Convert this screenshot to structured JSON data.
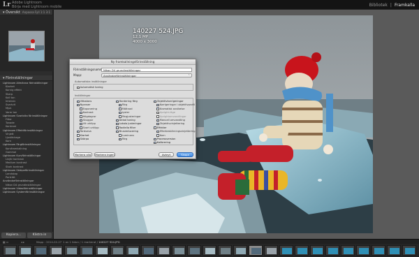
{
  "app": {
    "logo": "Lr",
    "id_plate_line1": "Adobe Lightroom",
    "id_plate_line2": "Börja med Lightroom mobile",
    "modules": [
      "Bibliotek",
      "Framkalla"
    ],
    "active_module": "Framkalla"
  },
  "left_panel": {
    "navigator_label": "Översikt",
    "navigator_options": [
      "Anpassa",
      "Fyll",
      "1:1",
      "3:1"
    ],
    "presets_label": "Förinställningar",
    "presets": [
      {
        "label": "Lightroom Allmänna förinställningar",
        "folder": true
      },
      {
        "label": "Klarhet",
        "folder": false
      },
      {
        "label": "Kornig effekt",
        "folder": false
      },
      {
        "label": "Skarp",
        "folder": false
      },
      {
        "label": "Kall ton",
        "folder": false
      },
      {
        "label": "Intensiv",
        "folder": false
      },
      {
        "label": "Svartvit",
        "folder": false
      },
      {
        "label": "Mjuk",
        "folder": false
      },
      {
        "label": "Varm ton",
        "folder": false
      },
      {
        "label": "Lightroom Svartvita förinställningar",
        "folder": true
      },
      {
        "label": "Filter",
        "folder": false
      },
      {
        "label": "Tonade",
        "folder": false
      },
      {
        "label": "Kontrast",
        "folder": false
      },
      {
        "label": "Lightroom Effektförinställningar",
        "folder": true
      },
      {
        "label": "Vinjett",
        "folder": false
      },
      {
        "label": "Ljusläckage",
        "folder": false
      },
      {
        "label": "Korn",
        "folder": false
      },
      {
        "label": "Lightroom Färgförinställningar",
        "folder": true
      },
      {
        "label": "Korsframkallning",
        "folder": false
      },
      {
        "label": "Gammal",
        "folder": false
      },
      {
        "label": "Lightroom Kurvförinställningar",
        "folder": true
      },
      {
        "label": "Linjär kontrast",
        "folder": false
      },
      {
        "label": "Medium kontrast",
        "folder": false
      },
      {
        "label": "Stark kontrast",
        "folder": false
      },
      {
        "label": "Lightroom Skärpeförinställningar",
        "folder": true
      },
      {
        "label": "Landskap",
        "folder": false
      },
      {
        "label": "Porträtt",
        "folder": false
      },
      {
        "label": "Användarförinställningar",
        "folder": true
      },
      {
        "label": "Nikon D4 grundinställningar",
        "folder": false
      },
      {
        "label": "Lightroom Videoförinställningar",
        "folder": true
      },
      {
        "label": "Lightroom Systemförinställningar",
        "folder": true
      }
    ],
    "copy_button": "Kopiera...",
    "paste_button": "Klistra in"
  },
  "photo_info": {
    "title": "140227 524.JPG",
    "line1": "12,1 MP",
    "line2": "4000 x 3000"
  },
  "dialog": {
    "title": "Ny framkallningsförinställning",
    "name_label": "Förinställningsnamn:",
    "name_value": "Nikon D4 grundinställningar",
    "folder_label": "Mapp:",
    "folder_value": "Användarförinställningar",
    "auto_group_label": "Automatiska inställningar",
    "auto_tone_label": "Automatisk toning",
    "settings_group_label": "Inställningar",
    "col1": [
      {
        "label": "Vitbalans",
        "checked": true,
        "level": 0
      },
      {
        "label": "Nyanser",
        "checked": true,
        "level": 0
      },
      {
        "label": "Exponering",
        "checked": true,
        "level": 1
      },
      {
        "label": "Kontrast",
        "checked": true,
        "level": 1
      },
      {
        "label": "Högdagrar",
        "checked": true,
        "level": 1
      },
      {
        "label": "Skuggor",
        "checked": true,
        "level": 1
      },
      {
        "label": "Vit urklipp",
        "checked": true,
        "level": 1
      },
      {
        "label": "Svart urklipp",
        "checked": true,
        "level": 1
      },
      {
        "label": "Tonkurva",
        "checked": true,
        "level": 0
      },
      {
        "label": "Klarhet",
        "checked": true,
        "level": 0
      },
      {
        "label": "Skärpa",
        "checked": true,
        "level": 0
      }
    ],
    "col2": [
      {
        "label": "Hantering färg",
        "checked": true,
        "level": 0
      },
      {
        "label": "Färg",
        "checked": true,
        "level": 1
      },
      {
        "label": "Mättnad",
        "checked": true,
        "level": 1
      },
      {
        "label": "Lyster",
        "checked": true,
        "level": 1
      },
      {
        "label": "Färgjusteringar",
        "checked": true,
        "level": 1
      },
      {
        "label": "Delad toning",
        "checked": true,
        "level": 0
      },
      {
        "label": "Lokala justeringar",
        "checked": true,
        "level": 0
      },
      {
        "label": "Radiella filter",
        "checked": true,
        "level": 0
      },
      {
        "label": "Brusreducering",
        "checked": true,
        "level": 0
      },
      {
        "label": "Luminans",
        "checked": true,
        "level": 1
      },
      {
        "label": "Färg",
        "checked": true,
        "level": 1
      }
    ],
    "col3": [
      {
        "label": "Objektivkorrigeringar",
        "checked": true,
        "level": 0
      },
      {
        "label": "Korrigeringar i objektivprofil",
        "checked": true,
        "level": 1
      },
      {
        "label": "Kromatisk avvikelse",
        "checked": true,
        "level": 1
      },
      {
        "label": "Upright-läge",
        "checked": false,
        "level": 1
      },
      {
        "label": "Uprightomvandlingar",
        "checked": false,
        "level": 1
      },
      {
        "label": "Manuell omvandling",
        "checked": true,
        "level": 1
      },
      {
        "label": "Objektivvinjettering",
        "checked": true,
        "level": 1
      },
      {
        "label": "Effekter",
        "checked": true,
        "level": 0
      },
      {
        "label": "Efterbeskärningsvinjettering",
        "checked": true,
        "level": 1
      },
      {
        "label": "Korn",
        "checked": true,
        "level": 1
      },
      {
        "label": "Processversion",
        "checked": true,
        "level": 0
      },
      {
        "label": "Kalibrering",
        "checked": true,
        "level": 0
      }
    ],
    "check_all": "Markera alla",
    "check_none": "Markera ingen",
    "cancel": "Avbryt",
    "create": "Skapa"
  },
  "toolbar": {
    "view_label": "Mapp : 2014-02-27",
    "count_label": "1 av 1 foton / 1 markerat /",
    "file_label": "140227 524.JPG"
  },
  "filmstrip": {
    "selected_index": 16
  },
  "colors": {
    "accent": "#3d86e0",
    "panel_bg": "#2d2d2d",
    "dialog_bg": "#dcdcdc"
  }
}
